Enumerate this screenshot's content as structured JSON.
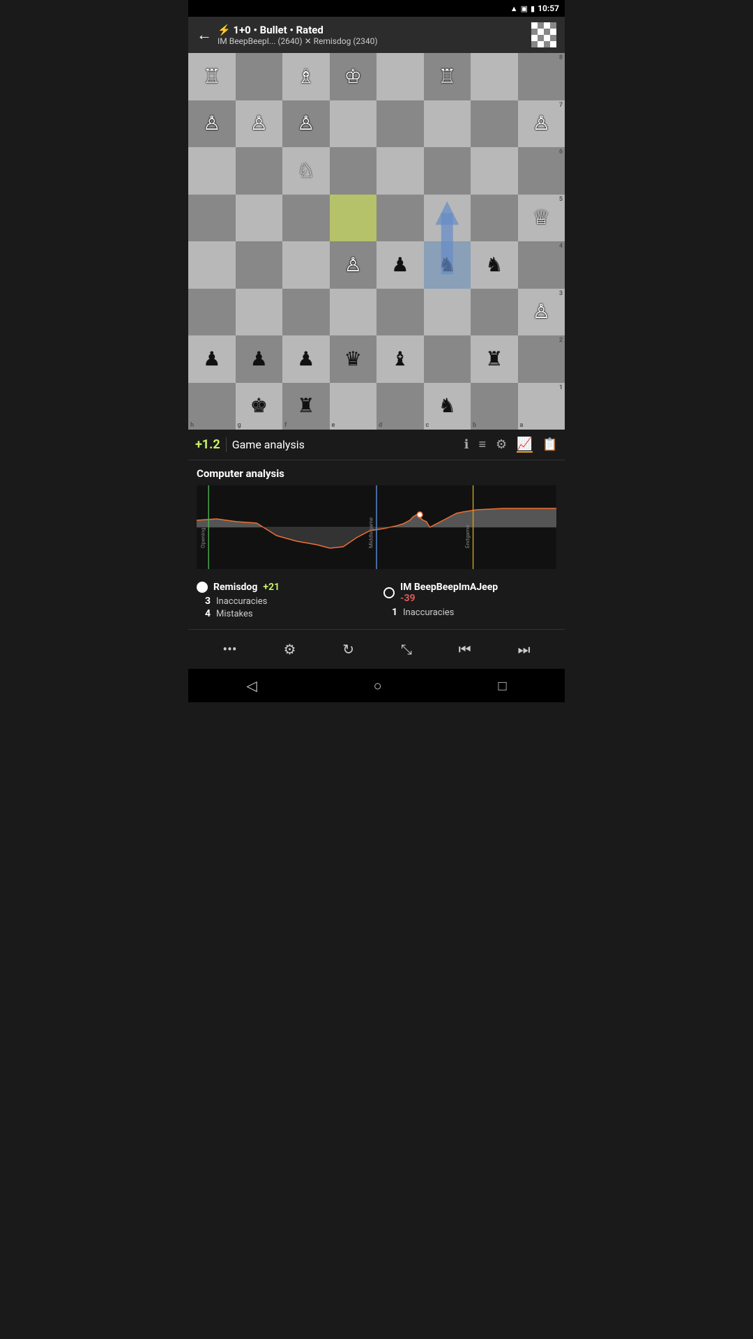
{
  "statusBar": {
    "time": "10:57"
  },
  "header": {
    "backLabel": "←",
    "gameType": "⚡ 1+0 • Bullet • Rated",
    "players": "IM BeepBeepI... (2640) ✕ Remisdog (2340)"
  },
  "toolbar": {
    "evalScore": "+1.2",
    "analysisLabel": "Game analysis",
    "icons": [
      "ℹ",
      "≡",
      "⚙",
      "📈",
      "📋"
    ]
  },
  "analysis": {
    "title": "Computer analysis",
    "chartLabels": {
      "opening": "Opening",
      "middlegame": "Middlegame",
      "endgame": "Endgame"
    }
  },
  "players": {
    "white": {
      "name": "Remisdog",
      "score": "+21",
      "scoreType": "positive",
      "stats": [
        {
          "num": "3",
          "label": "Inaccuracies"
        },
        {
          "num": "4",
          "label": "Mistakes"
        }
      ]
    },
    "black": {
      "name": "IM BeepBeepImAJeep",
      "score": "-39",
      "scoreType": "negative",
      "stats": [
        {
          "num": "1",
          "label": "Inaccuracies"
        }
      ]
    }
  },
  "bottomToolbar": {
    "buttons": [
      "•••",
      "⚙",
      "↻",
      "⤡",
      "⏮",
      "⏭"
    ]
  },
  "navBar": {
    "back": "◁",
    "home": "○",
    "recent": "□"
  },
  "board": {
    "files": [
      "h",
      "g",
      "f",
      "e",
      "d",
      "c",
      "b",
      "a"
    ],
    "ranks": [
      "1",
      "2",
      "3",
      "4",
      "5",
      "6",
      "7",
      "8"
    ]
  }
}
